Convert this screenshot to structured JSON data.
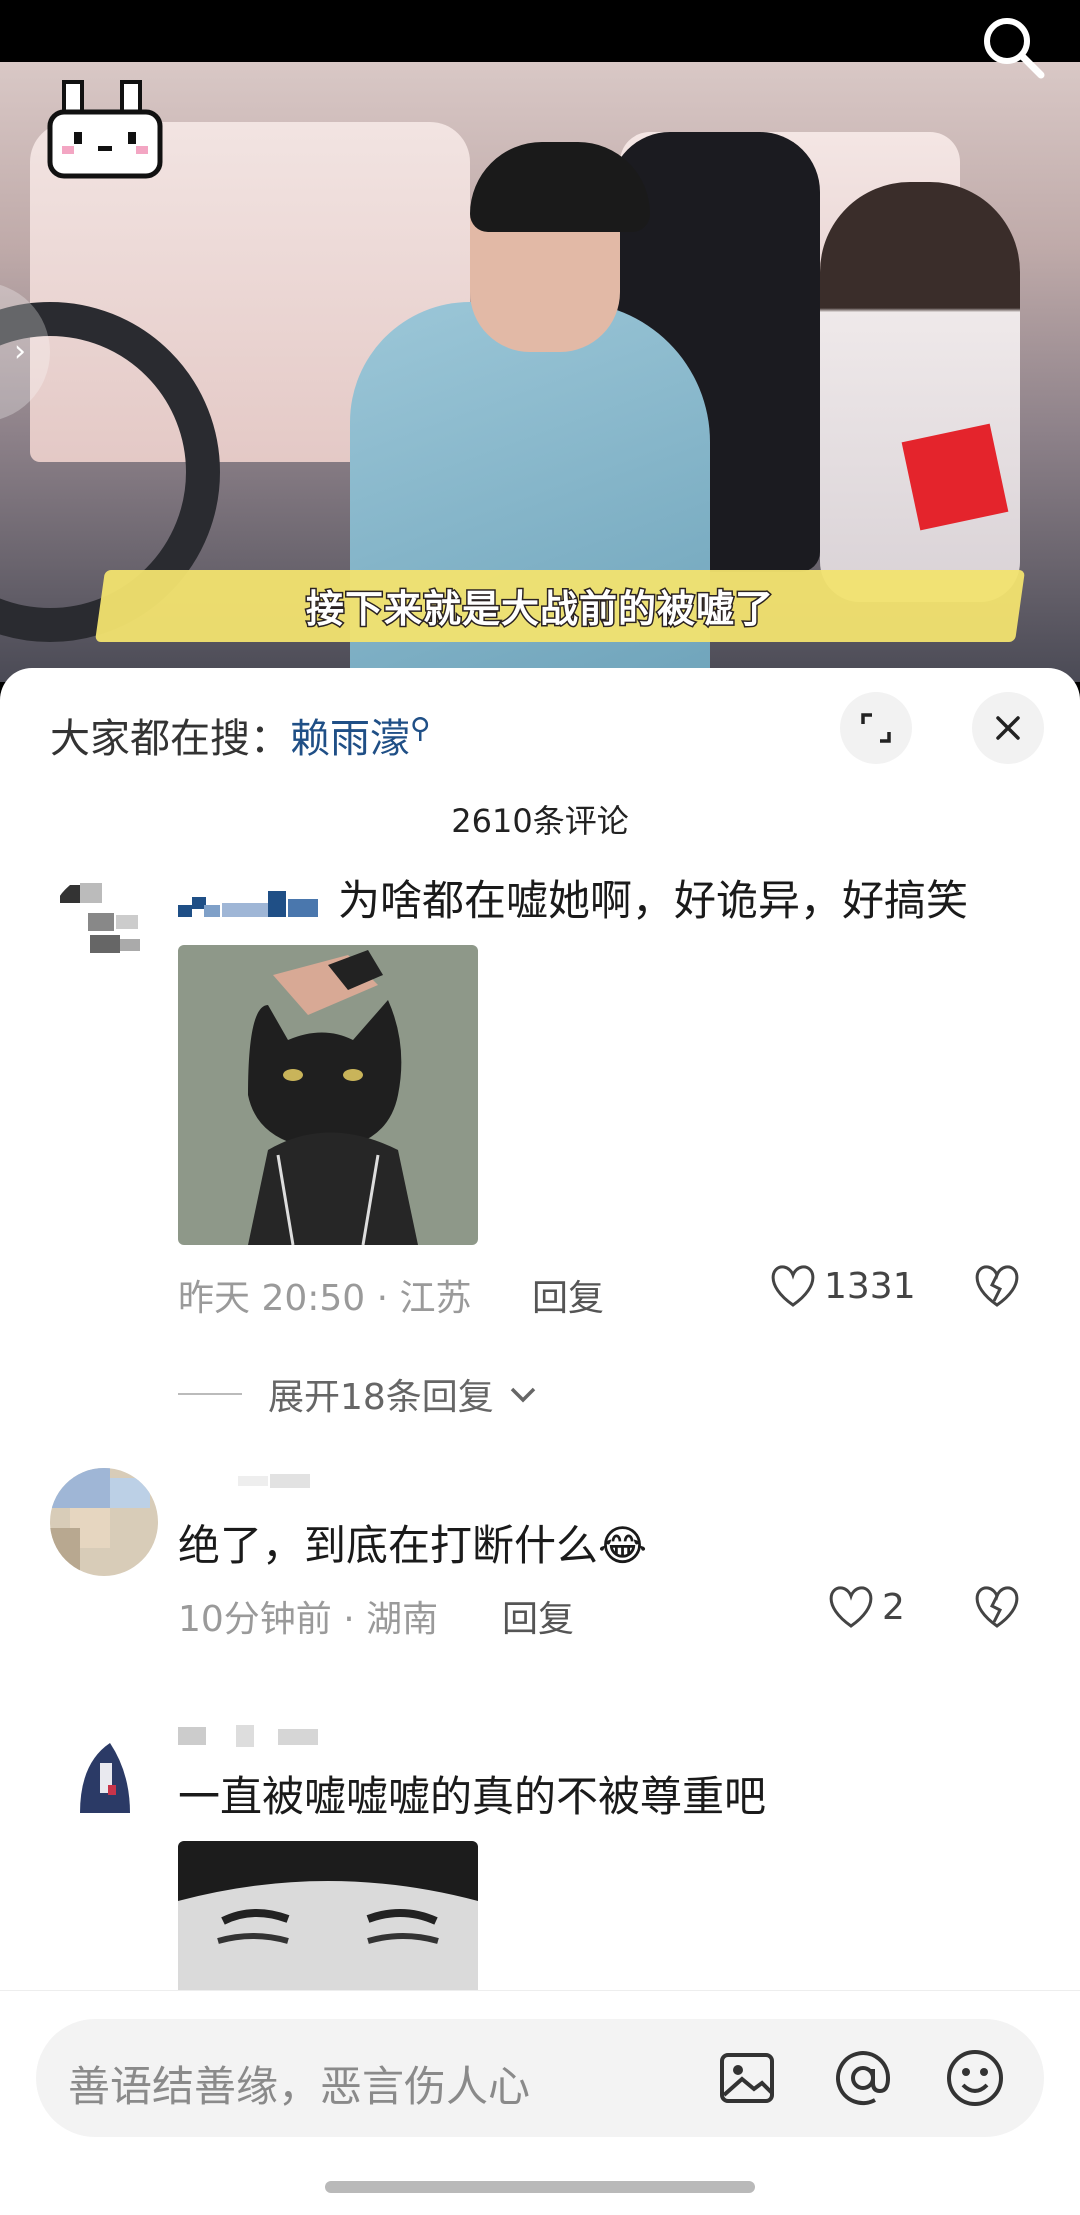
{
  "video": {
    "subtitle": "接下来就是大战前的被嘘了"
  },
  "hot_search": {
    "prefix": "大家都在搜：",
    "keyword": "赖雨濛"
  },
  "comment_count": "2610条评论",
  "comments": [
    {
      "text": "为啥都在嘘她啊，好诡异，好搞笑",
      "time_location": "昨天 20:50 · 江苏",
      "reply_label": "回复",
      "likes": "1331",
      "has_sticker": true,
      "expand_label": "展开18条回复"
    },
    {
      "text": "绝了，到底在打断什么",
      "emoji": "😂",
      "time_location": "10分钟前 · 湖南",
      "reply_label": "回复",
      "likes": "2"
    },
    {
      "text": "一直被嘘嘘嘘的真的不被尊重吧",
      "has_sticker": true
    }
  ],
  "input": {
    "placeholder": "善语结善缘，恶言伤人心"
  },
  "icons": {
    "search": "search-icon",
    "expand": "expand-icon",
    "close": "close-icon",
    "like": "heart-icon",
    "dislike": "broken-heart-icon",
    "image": "image-icon",
    "mention": "at-icon",
    "emoji": "emoji-icon"
  },
  "colors": {
    "keyword": "#1f4f86",
    "subtitle_band": "#f2e36f"
  }
}
